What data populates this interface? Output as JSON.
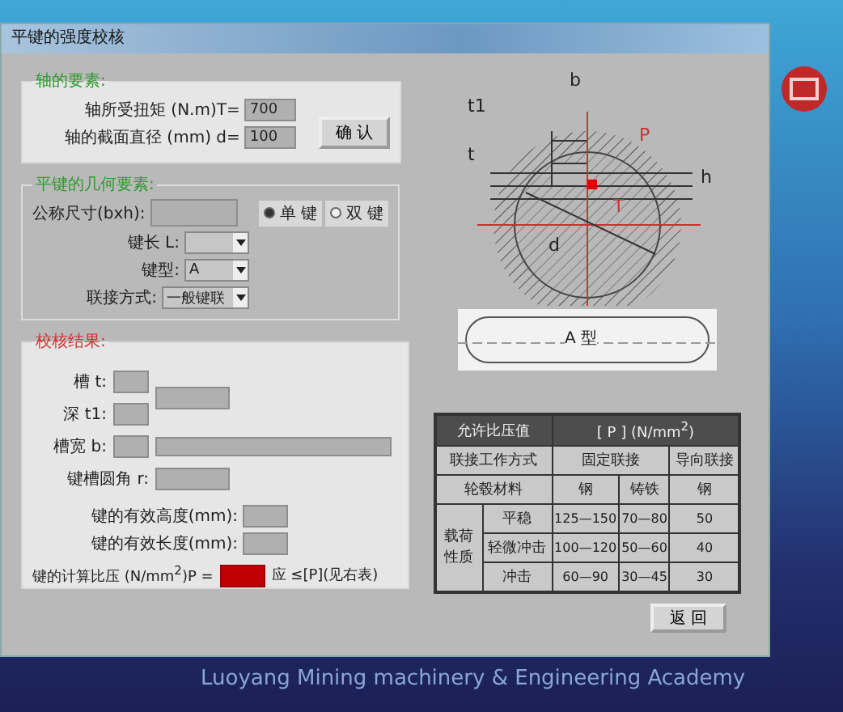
{
  "window": {
    "title": "平键的强度校核"
  },
  "shaft_group": {
    "title": "轴的要素:",
    "fields": [
      {
        "label": "轴所受扭矩 (N.m)T=",
        "value": "700"
      },
      {
        "label": "轴的截面直径 (mm) d=",
        "value": "100"
      }
    ],
    "confirm_button": "确 认"
  },
  "key_group": {
    "title": "平键的几何要素:",
    "size_label": "公称尺寸(bxh):",
    "radios": [
      {
        "label": "单 键",
        "selected": true
      },
      {
        "label": "双 键",
        "selected": false
      }
    ],
    "dropdowns": [
      {
        "label": "键长 L:"
      },
      {
        "label": "键型:",
        "value": "A"
      },
      {
        "label": "联接方式:",
        "value": "一般键联"
      }
    ]
  },
  "result_group": {
    "title": "校核结果:",
    "depth_labels": [
      "槽 t:",
      "深 t1:"
    ],
    "width_label": "槽宽 b:",
    "radius_label": "键槽圆角 r:",
    "effective": [
      {
        "label": "键的有效高度(mm):"
      },
      {
        "label": "键的有效长度(mm):"
      }
    ],
    "pressure": {
      "label": "键的计算比压 (N/mm$^{2}$)P =",
      "alert": true,
      "note": "应 ≤[P](见右表)"
    }
  },
  "section_drawing": {
    "labels": [
      "b",
      "t1",
      "t",
      "h",
      "P",
      "T",
      "d"
    ]
  },
  "key_type_drawing": {
    "label": "A 型"
  },
  "table": {
    "title": "允许比压值",
    "unit": "[ P ]   (N/mm$^{2}$)",
    "mode_label": "联接工作方式",
    "modes": [
      "固定联接",
      "导向联接"
    ],
    "hub_label": "轮毂材料",
    "hubs": [
      "钢",
      "铸铁",
      "钢"
    ],
    "load_label": "载荷性质",
    "rows": [
      {
        "load": "平稳",
        "values": [
          "125—150",
          "70—80",
          "50"
        ]
      },
      {
        "load": "轻微冲击",
        "values": [
          "100—120",
          "50—60",
          "40"
        ]
      },
      {
        "load": "冲击",
        "values": [
          "60—90",
          "30—45",
          "30"
        ]
      }
    ]
  },
  "return_button": "返 回",
  "desktop": {
    "caption": "Luoyang Mining machinery & Engineering Academy"
  }
}
